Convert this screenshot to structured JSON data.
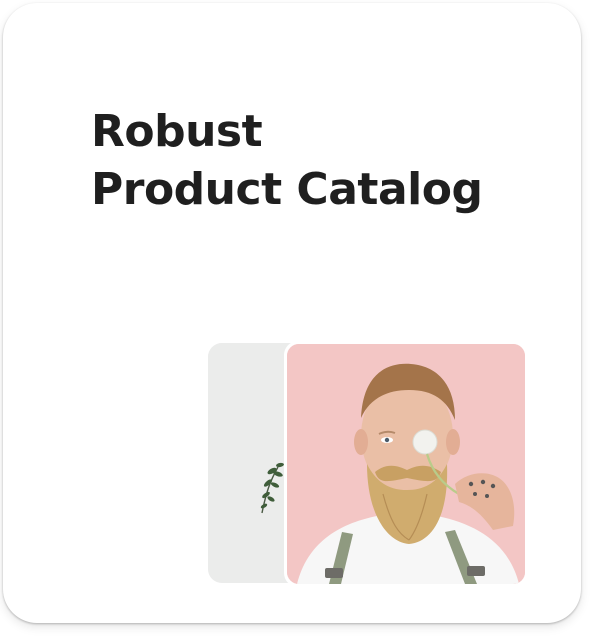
{
  "card": {
    "title_line1": "Robust",
    "title_line2": "Product Catalog"
  },
  "gallery": {
    "back_image": "plant-sprig-image",
    "front_image": "bearded-man-with-dandelion-image"
  },
  "colors": {
    "title": "#1f1f1f",
    "front_background": "#f2c5c4",
    "back_background": "#e9eaea"
  }
}
